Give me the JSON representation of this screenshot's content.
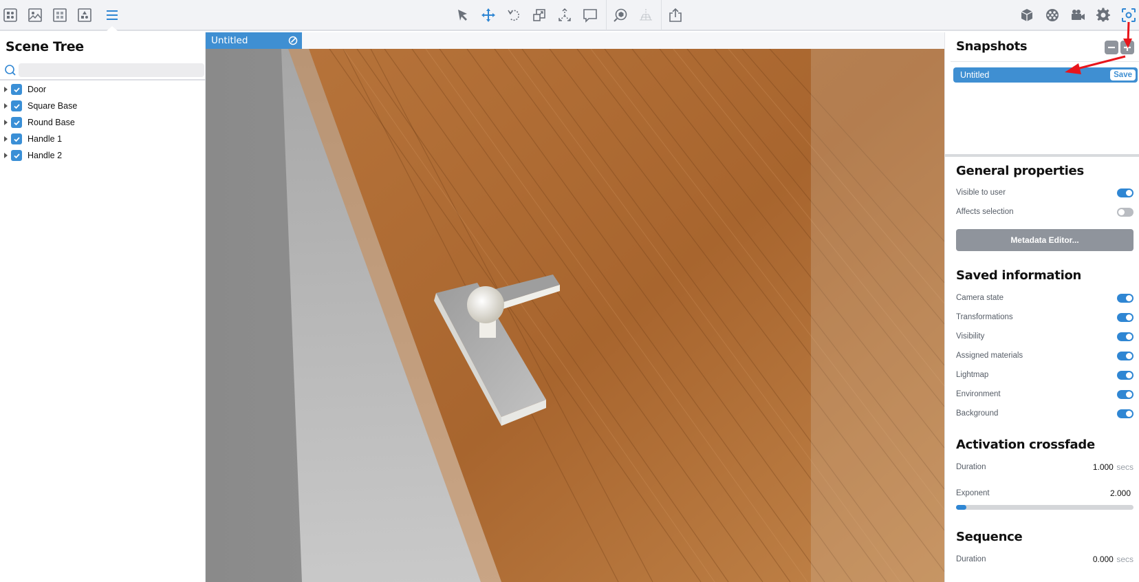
{
  "toolbar": {
    "left_icons": [
      {
        "name": "scene-layout-icon"
      },
      {
        "name": "image-icon"
      },
      {
        "name": "materials-grid-icon"
      },
      {
        "name": "shapes-icon"
      },
      {
        "name": "scene-tree-menu-icon",
        "active": true
      }
    ],
    "center_icons": [
      {
        "name": "select-arrow-icon"
      },
      {
        "name": "move-icon",
        "active": true
      },
      {
        "name": "rotate-icon"
      },
      {
        "name": "scale-icon"
      },
      {
        "name": "pivot-icon"
      },
      {
        "name": "annotation-icon"
      },
      {
        "name": "inspect-model-icon"
      },
      {
        "name": "ground-grid-icon",
        "disabled": true
      },
      {
        "name": "share-export-icon"
      }
    ],
    "right_icons": [
      {
        "name": "model-cube-icon"
      },
      {
        "name": "environment-sphere-icon"
      },
      {
        "name": "camera-video-icon"
      },
      {
        "name": "settings-gear-icon"
      },
      {
        "name": "snapshot-screenshot-icon",
        "active": true
      }
    ]
  },
  "scene_tree": {
    "title": "Scene Tree",
    "search_placeholder": "",
    "items": [
      {
        "label": "Door",
        "checked": true
      },
      {
        "label": "Square Base",
        "checked": true
      },
      {
        "label": "Round Base",
        "checked": true
      },
      {
        "label": "Handle 1",
        "checked": true
      },
      {
        "label": "Handle 2",
        "checked": true
      }
    ]
  },
  "viewport": {
    "tab_label": "Untitled"
  },
  "snapshots": {
    "title": "Snapshots",
    "remove_label": "−",
    "add_label": "+",
    "items": [
      {
        "label": "Untitled",
        "save_label": "Save",
        "selected": true
      }
    ]
  },
  "general_properties": {
    "title": "General properties",
    "rows": [
      {
        "label": "Visible to user",
        "on": true
      },
      {
        "label": "Affects selection",
        "on": false
      }
    ],
    "metadata_button": "Metadata Editor..."
  },
  "saved_information": {
    "title": "Saved information",
    "rows": [
      {
        "label": "Camera state",
        "on": true
      },
      {
        "label": "Transformations",
        "on": true
      },
      {
        "label": "Visibility",
        "on": true
      },
      {
        "label": "Assigned materials",
        "on": true
      },
      {
        "label": "Lightmap",
        "on": true
      },
      {
        "label": "Environment",
        "on": true
      },
      {
        "label": "Background",
        "on": true
      }
    ]
  },
  "activation_crossfade": {
    "title": "Activation crossfade",
    "duration_label": "Duration",
    "duration_value": "1.000",
    "duration_unit": "secs",
    "exponent_label": "Exponent",
    "exponent_value": "2.000",
    "exponent_slider_fraction": 0.06
  },
  "sequence": {
    "title": "Sequence",
    "duration_label": "Duration",
    "duration_value": "0.000",
    "duration_unit": "secs"
  },
  "colors": {
    "accent": "#3f8fd2",
    "toggle_on": "#2f86d3",
    "toggle_off": "#b9bcc1",
    "annotation_arrow": "#e8151b"
  }
}
